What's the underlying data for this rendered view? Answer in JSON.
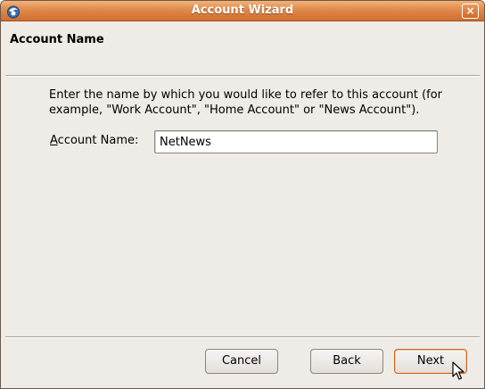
{
  "window": {
    "title": "Account Wizard",
    "close_symbol": "×"
  },
  "page": {
    "heading": "Account Name",
    "description": "Enter the name by which you would like to refer to this account (for example, \"Work Account\", \"Home Account\" or \"News Account\").",
    "field_label_rest": "ccount Name:",
    "field_label_mnemonic": "A",
    "field_value": "NetNews"
  },
  "buttons": {
    "cancel": "Cancel",
    "back": "Back",
    "next": "Next"
  },
  "icons": {
    "app": "thunderbird-icon",
    "close": "close-icon",
    "pointer": "mouse-pointer-icon"
  },
  "colors": {
    "titlebar": "#e0894a",
    "window_bg": "#efebe7",
    "focus_border": "#c4672a"
  }
}
